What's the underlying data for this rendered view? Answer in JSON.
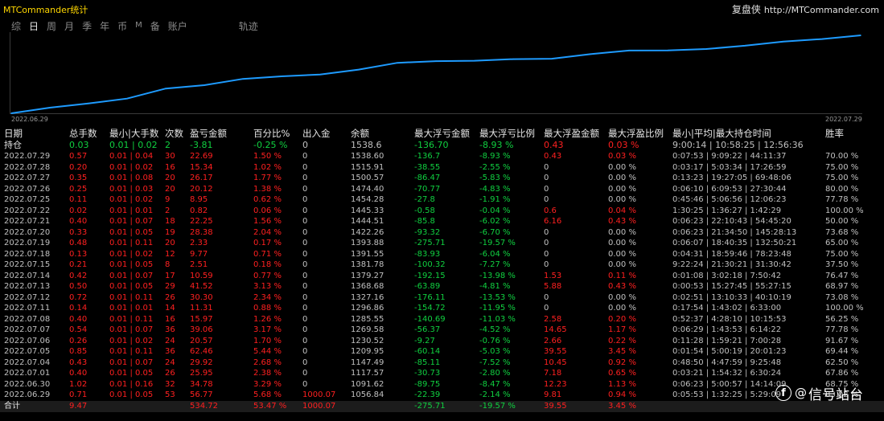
{
  "app": {
    "title": "MTCommander统计",
    "brand_cn": "复盘侠",
    "brand_url": "http://MTCommander.com"
  },
  "tabs": [
    {
      "label": "综"
    },
    {
      "label": "日"
    },
    {
      "label": "周"
    },
    {
      "label": "月"
    },
    {
      "label": "季"
    },
    {
      "label": "年"
    },
    {
      "label": "币"
    },
    {
      "label": "M"
    },
    {
      "label": "备"
    },
    {
      "label": "账户"
    },
    {
      "label": "轨迹"
    }
  ],
  "active_tab": "日",
  "chart_data": {
    "type": "line",
    "x_start": "2022.06.29",
    "x_end": "2022.07.29",
    "x": [
      "2022.06.29",
      "2022.06.30",
      "2022.07.01",
      "2022.07.04",
      "2022.07.05",
      "2022.07.06",
      "2022.07.07",
      "2022.07.08",
      "2022.07.11",
      "2022.07.12",
      "2022.07.13",
      "2022.07.14",
      "2022.07.15",
      "2022.07.18",
      "2022.07.19",
      "2022.07.20",
      "2022.07.21",
      "2022.07.22",
      "2022.07.25",
      "2022.07.26",
      "2022.07.27",
      "2022.07.28",
      "2022.07.29"
    ],
    "values": [
      1056.84,
      1091.62,
      1117.57,
      1147.49,
      1209.95,
      1230.52,
      1269.58,
      1285.55,
      1296.86,
      1327.16,
      1368.68,
      1379.27,
      1381.78,
      1391.55,
      1393.88,
      1422.26,
      1444.51,
      1445.33,
      1454.28,
      1474.4,
      1500.57,
      1515.91,
      1538.6
    ],
    "color": "#1e9bff",
    "grid": false
  },
  "table": {
    "headers": [
      "日期",
      "总手数",
      "最小|大手数",
      "次数",
      "盈亏金额",
      "百分比%",
      "出入金",
      "余额",
      "最大浮亏金额",
      "最大浮亏比例",
      "最大浮盈金额",
      "最大浮盈比例",
      "最小|平均|最大持仓时间",
      "胜率"
    ],
    "holding": {
      "date": "持仓",
      "lots": "0.03",
      "minmax": "0.01 | 0.02",
      "count": "2",
      "pnl": "-3.81",
      "pct": "-0.25 %",
      "flow": "0",
      "balance": "1538.6",
      "max_float_loss": "-136.70",
      "max_float_loss_pct": "-8.93 %",
      "max_float_profit": "0.43",
      "max_float_profit_pct": "0.03 %",
      "hold_time": "9:00:14 | 10:58:25 | 12:56:36",
      "winrate": ""
    },
    "rows": [
      {
        "date": "2022.07.29",
        "lots": "0.57",
        "minmax": "0.01 | 0.04",
        "count": "30",
        "pnl": "22.69",
        "pct": "1.50 %",
        "flow": "0",
        "balance": "1538.60",
        "max_float_loss": "-136.7",
        "max_float_loss_pct": "-8.93 %",
        "max_float_profit": "0.43",
        "max_float_profit_pct": "0.03 %",
        "hold_time": "0:07:53 | 9:09:22 | 44:11:37",
        "winrate": "70.00 %"
      },
      {
        "date": "2022.07.28",
        "lots": "0.20",
        "minmax": "0.01 | 0.02",
        "count": "16",
        "pnl": "15.34",
        "pct": "1.02 %",
        "flow": "0",
        "balance": "1515.91",
        "max_float_loss": "-38.55",
        "max_float_loss_pct": "-2.55 %",
        "max_float_profit": "0",
        "max_float_profit_pct": "0.00 %",
        "hold_time": "0:03:17 | 5:03:34 | 17:26:59",
        "winrate": "75.00 %"
      },
      {
        "date": "2022.07.27",
        "lots": "0.35",
        "minmax": "0.01 | 0.08",
        "count": "20",
        "pnl": "26.17",
        "pct": "1.77 %",
        "flow": "0",
        "balance": "1500.57",
        "max_float_loss": "-86.47",
        "max_float_loss_pct": "-5.83 %",
        "max_float_profit": "0",
        "max_float_profit_pct": "0.00 %",
        "hold_time": "0:13:23 | 19:27:05 | 69:48:06",
        "winrate": "75.00 %"
      },
      {
        "date": "2022.07.26",
        "lots": "0.25",
        "minmax": "0.01 | 0.03",
        "count": "20",
        "pnl": "20.12",
        "pct": "1.38 %",
        "flow": "0",
        "balance": "1474.40",
        "max_float_loss": "-70.77",
        "max_float_loss_pct": "-4.83 %",
        "max_float_profit": "0",
        "max_float_profit_pct": "0.00 %",
        "hold_time": "0:06:10 | 6:09:53 | 27:30:44",
        "winrate": "80.00 %"
      },
      {
        "date": "2022.07.25",
        "lots": "0.11",
        "minmax": "0.01 | 0.02",
        "count": "9",
        "pnl": "8.95",
        "pct": "0.62 %",
        "flow": "0",
        "balance": "1454.28",
        "max_float_loss": "-27.8",
        "max_float_loss_pct": "-1.91 %",
        "max_float_profit": "0",
        "max_float_profit_pct": "0.00 %",
        "hold_time": "0:45:46 | 5:06:56 | 12:06:23",
        "winrate": "77.78 %"
      },
      {
        "date": "2022.07.22",
        "lots": "0.02",
        "minmax": "0.01 | 0.01",
        "count": "2",
        "pnl": "0.82",
        "pct": "0.06 %",
        "flow": "0",
        "balance": "1445.33",
        "max_float_loss": "-0.58",
        "max_float_loss_pct": "-0.04 %",
        "max_float_profit": "0.6",
        "max_float_profit_pct": "0.04 %",
        "hold_time": "1:30:25 | 1:36:27 | 1:42:29",
        "winrate": "100.00 %"
      },
      {
        "date": "2022.07.21",
        "lots": "0.40",
        "minmax": "0.01 | 0.07",
        "count": "18",
        "pnl": "22.25",
        "pct": "1.56 %",
        "flow": "0",
        "balance": "1444.51",
        "max_float_loss": "-85.8",
        "max_float_loss_pct": "-6.02 %",
        "max_float_profit": "6.16",
        "max_float_profit_pct": "0.43 %",
        "hold_time": "0:06:23 | 22:10:43 | 54:45:20",
        "winrate": "50.00 %"
      },
      {
        "date": "2022.07.20",
        "lots": "0.33",
        "minmax": "0.01 | 0.05",
        "count": "19",
        "pnl": "28.38",
        "pct": "2.04 %",
        "flow": "0",
        "balance": "1422.26",
        "max_float_loss": "-93.32",
        "max_float_loss_pct": "-6.70 %",
        "max_float_profit": "0",
        "max_float_profit_pct": "0.00 %",
        "hold_time": "0:06:23 | 21:34:50 | 145:28:13",
        "winrate": "73.68 %"
      },
      {
        "date": "2022.07.19",
        "lots": "0.48",
        "minmax": "0.01 | 0.11",
        "count": "20",
        "pnl": "2.33",
        "pct": "0.17 %",
        "flow": "0",
        "balance": "1393.88",
        "max_float_loss": "-275.71",
        "max_float_loss_pct": "-19.57 %",
        "max_float_profit": "0",
        "max_float_profit_pct": "0.00 %",
        "hold_time": "0:06:07 | 18:40:35 | 132:50:21",
        "winrate": "65.00 %"
      },
      {
        "date": "2022.07.18",
        "lots": "0.13",
        "minmax": "0.01 | 0.02",
        "count": "12",
        "pnl": "9.77",
        "pct": "0.71 %",
        "flow": "0",
        "balance": "1391.55",
        "max_float_loss": "-83.93",
        "max_float_loss_pct": "-6.04 %",
        "max_float_profit": "0",
        "max_float_profit_pct": "0.00 %",
        "hold_time": "0:04:31 | 18:59:46 | 78:23:48",
        "winrate": "75.00 %"
      },
      {
        "date": "2022.07.15",
        "lots": "0.21",
        "minmax": "0.01 | 0.05",
        "count": "8",
        "pnl": "2.51",
        "pct": "0.18 %",
        "flow": "0",
        "balance": "1381.78",
        "max_float_loss": "-100.32",
        "max_float_loss_pct": "-7.27 %",
        "max_float_profit": "0",
        "max_float_profit_pct": "0.00 %",
        "hold_time": "9:22:24 | 21:30:21 | 31:30:42",
        "winrate": "37.50 %"
      },
      {
        "date": "2022.07.14",
        "lots": "0.42",
        "minmax": "0.01 | 0.07",
        "count": "17",
        "pnl": "10.59",
        "pct": "0.77 %",
        "flow": "0",
        "balance": "1379.27",
        "max_float_loss": "-192.15",
        "max_float_loss_pct": "-13.98 %",
        "max_float_profit": "1.53",
        "max_float_profit_pct": "0.11 %",
        "hold_time": "0:01:08 | 3:02:18 | 7:50:42",
        "winrate": "76.47 %"
      },
      {
        "date": "2022.07.13",
        "lots": "0.50",
        "minmax": "0.01 | 0.05",
        "count": "29",
        "pnl": "41.52",
        "pct": "3.13 %",
        "flow": "0",
        "balance": "1368.68",
        "max_float_loss": "-63.89",
        "max_float_loss_pct": "-4.81 %",
        "max_float_profit": "5.88",
        "max_float_profit_pct": "0.43 %",
        "hold_time": "0:00:53 | 15:27:45 | 55:27:15",
        "winrate": "68.97 %"
      },
      {
        "date": "2022.07.12",
        "lots": "0.72",
        "minmax": "0.01 | 0.11",
        "count": "26",
        "pnl": "30.30",
        "pct": "2.34 %",
        "flow": "0",
        "balance": "1327.16",
        "max_float_loss": "-176.11",
        "max_float_loss_pct": "-13.53 %",
        "max_float_profit": "0",
        "max_float_profit_pct": "0.00 %",
        "hold_time": "0:02:51 | 13:10:33 | 40:10:19",
        "winrate": "73.08 %"
      },
      {
        "date": "2022.07.11",
        "lots": "0.14",
        "minmax": "0.01 | 0.01",
        "count": "14",
        "pnl": "11.31",
        "pct": "0.88 %",
        "flow": "0",
        "balance": "1296.86",
        "max_float_loss": "-154.72",
        "max_float_loss_pct": "-11.95 %",
        "max_float_profit": "0",
        "max_float_profit_pct": "0.00 %",
        "hold_time": "0:17:54 | 1:43:02 | 6:33:00",
        "winrate": "100.00 %"
      },
      {
        "date": "2022.07.08",
        "lots": "0.40",
        "minmax": "0.01 | 0.11",
        "count": "16",
        "pnl": "15.97",
        "pct": "1.26 %",
        "flow": "0",
        "balance": "1285.55",
        "max_float_loss": "-140.69",
        "max_float_loss_pct": "-11.03 %",
        "max_float_profit": "2.58",
        "max_float_profit_pct": "0.20 %",
        "hold_time": "0:52:37 | 4:28:10 | 10:15:53",
        "winrate": "56.25 %"
      },
      {
        "date": "2022.07.07",
        "lots": "0.54",
        "minmax": "0.01 | 0.07",
        "count": "36",
        "pnl": "39.06",
        "pct": "3.17 %",
        "flow": "0",
        "balance": "1269.58",
        "max_float_loss": "-56.37",
        "max_float_loss_pct": "-4.52 %",
        "max_float_profit": "14.65",
        "max_float_profit_pct": "1.17 %",
        "hold_time": "0:06:29 | 1:43:53 | 6:14:22",
        "winrate": "77.78 %"
      },
      {
        "date": "2022.07.06",
        "lots": "0.26",
        "minmax": "0.01 | 0.02",
        "count": "24",
        "pnl": "20.57",
        "pct": "1.70 %",
        "flow": "0",
        "balance": "1230.52",
        "max_float_loss": "-9.27",
        "max_float_loss_pct": "-0.76 %",
        "max_float_profit": "2.66",
        "max_float_profit_pct": "0.22 %",
        "hold_time": "0:11:28 | 1:59:21 | 7:00:28",
        "winrate": "91.67 %"
      },
      {
        "date": "2022.07.05",
        "lots": "0.85",
        "minmax": "0.01 | 0.11",
        "count": "36",
        "pnl": "62.46",
        "pct": "5.44 %",
        "flow": "0",
        "balance": "1209.95",
        "max_float_loss": "-60.14",
        "max_float_loss_pct": "-5.03 %",
        "max_float_profit": "39.55",
        "max_float_profit_pct": "3.45 %",
        "hold_time": "0:01:54 | 5:00:19 | 20:01:23",
        "winrate": "69.44 %"
      },
      {
        "date": "2022.07.04",
        "lots": "0.43",
        "minmax": "0.01 | 0.07",
        "count": "24",
        "pnl": "29.92",
        "pct": "2.68 %",
        "flow": "0",
        "balance": "1147.49",
        "max_float_loss": "-85.11",
        "max_float_loss_pct": "-7.52 %",
        "max_float_profit": "10.45",
        "max_float_profit_pct": "0.92 %",
        "hold_time": "0:48:50 | 4:47:59 | 9:25:48",
        "winrate": "62.50 %"
      },
      {
        "date": "2022.07.01",
        "lots": "0.40",
        "minmax": "0.01 | 0.05",
        "count": "26",
        "pnl": "25.95",
        "pct": "2.38 %",
        "flow": "0",
        "balance": "1117.57",
        "max_float_loss": "-30.73",
        "max_float_loss_pct": "-2.80 %",
        "max_float_profit": "7.18",
        "max_float_profit_pct": "0.65 %",
        "hold_time": "0:03:21 | 1:54:32 | 6:30:24",
        "winrate": "67.86 %"
      },
      {
        "date": "2022.06.30",
        "lots": "1.02",
        "minmax": "0.01 | 0.16",
        "count": "32",
        "pnl": "34.78",
        "pct": "3.29 %",
        "flow": "0",
        "balance": "1091.62",
        "max_float_loss": "-89.75",
        "max_float_loss_pct": "-8.47 %",
        "max_float_profit": "12.23",
        "max_float_profit_pct": "1.13 %",
        "hold_time": "0:06:23 | 5:00:57 | 14:14:09",
        "winrate": "68.75 %"
      },
      {
        "date": "2022.06.29",
        "lots": "0.71",
        "minmax": "0.01 | 0.05",
        "count": "53",
        "pnl": "56.77",
        "pct": "5.68 %",
        "flow": "1000.07",
        "balance": "1056.84",
        "max_float_loss": "-22.39",
        "max_float_loss_pct": "-2.14 %",
        "max_float_profit": "9.81",
        "max_float_profit_pct": "0.94 %",
        "hold_time": "0:05:53 | 1:32:25 | 5:29:09",
        "winrate": "83.02 %"
      }
    ],
    "total": {
      "date": "合计",
      "lots": "9.47",
      "pnl": "534.72",
      "pct": "53.47 %",
      "flow": "1000.07",
      "max_float_loss": "-275.71",
      "max_float_loss_pct": "-19.57 %",
      "max_float_profit": "39.55",
      "max_float_profit_pct": "3.45 %"
    }
  },
  "watermark": {
    "icon": "f",
    "at": "@",
    "text": "信号站台"
  },
  "colors": {
    "positive": "#ff2020",
    "negative": "#10d040",
    "line": "#1e9bff",
    "title": "#ffd700"
  }
}
